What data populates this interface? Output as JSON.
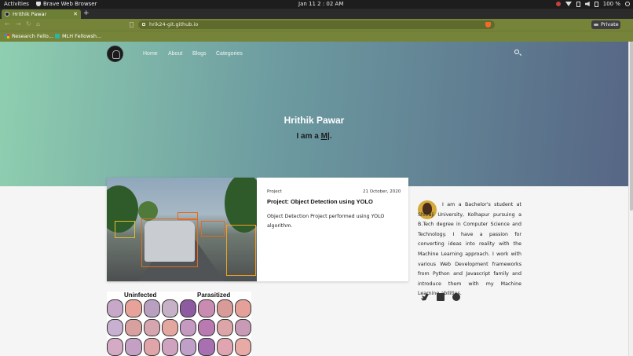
{
  "os_bar": {
    "activities": "Activities",
    "app_name": "Brave Web Browser",
    "clock": "Jan 11  2 : 02 AM",
    "battery": "100 %"
  },
  "browser": {
    "tab_title": "Hrithik Pawar",
    "url": "hrik24-git.github.io",
    "private_label": "Private",
    "bookmarks": [
      "Research Fello...",
      "MLH Fellowsh..."
    ]
  },
  "site": {
    "nav": [
      "Home",
      "About",
      "Blogs",
      "Categories"
    ],
    "hero_title": "Hrithik Pawar",
    "hero_prefix": "I am a ",
    "hero_typed": "M|",
    "hero_suffix": "."
  },
  "post": {
    "category": "Project",
    "date": "21 October, 2020",
    "title": "Project: Object Detection using YOLO",
    "description": "Object Detection Project performed using YOLO algorithm."
  },
  "post2": {
    "left_label": "Uninfected",
    "right_label": "Parasitized"
  },
  "sidebar": {
    "bio": "I am a Bachelor's student at Shivaji University, Kolhapur pursuing a B.Tech degree in Computer Science and Technology. I have a passion for converting ideas into reality with the Machine Learning approach. I work with various Web Development frameworks from Python and Javascript family and introduce them with my Machine Learning abilities.",
    "socials": [
      "twitter-icon",
      "linkedin-icon",
      "github-icon"
    ]
  },
  "colors": {
    "tab_active": "#6d7e35",
    "toolbar": "#76843a",
    "hero_start": "#8fcfb0",
    "hero_end": "#566685"
  }
}
